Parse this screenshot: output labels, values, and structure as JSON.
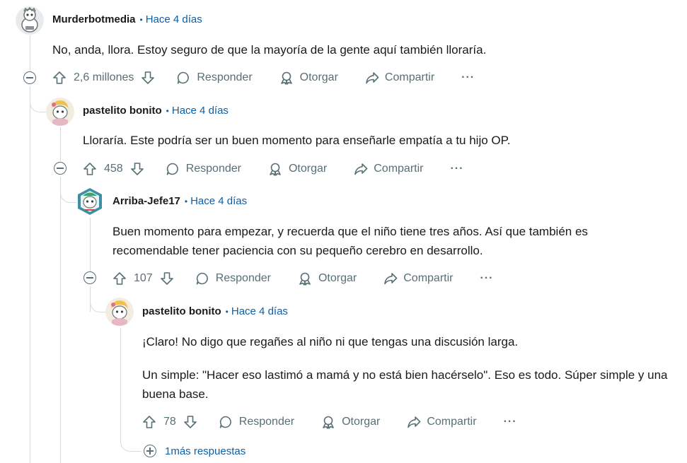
{
  "comments": [
    {
      "author": "Murderbotmedia",
      "time": "Hace 4 días",
      "body": [
        "No, anda, llora. Estoy seguro de que la mayoría de la gente aquí también lloraría."
      ],
      "votes": "2,6 millones",
      "reply": "Responder",
      "award": "Otorgar",
      "share": "Compartir",
      "more": "···"
    },
    {
      "author": "pastelito bonito",
      "time": "Hace 4 días",
      "body": [
        "Lloraría. Este podría ser un buen momento para enseñarle empatía a tu hijo OP."
      ],
      "votes": "458",
      "reply": "Responder",
      "award": "Otorgar",
      "share": "Compartir",
      "more": "···"
    },
    {
      "author": "Arriba-Jefe17",
      "time": "Hace 4 días",
      "body": [
        "Buen momento para empezar, y recuerda que el niño tiene tres años. Así que también es recomendable tener paciencia con su pequeño cerebro en desarrollo."
      ],
      "votes": "107",
      "reply": "Responder",
      "award": "Otorgar",
      "share": "Compartir",
      "more": "···"
    },
    {
      "author": "pastelito bonito",
      "time": "Hace 4 días",
      "body": [
        "¡Claro! No digo que regañes al niño ni que tengas una discusión larga.",
        "Un simple: \"Hacer eso lastimó a mamá y no está bien hacérselo\". Eso es todo. Súper simple y una buena base."
      ],
      "votes": "78",
      "reply": "Responder",
      "award": "Otorgar",
      "share": "Compartir",
      "more": "···"
    }
  ],
  "more_replies": {
    "count": "1",
    "label": "más respuestas"
  },
  "colors": {
    "link_blue": "#0a5fa8",
    "icon_gray": "#576f76",
    "thread_line": "#d7dadc"
  },
  "icons": [
    "upvote-icon",
    "downvote-icon",
    "comment-icon",
    "award-icon",
    "share-icon",
    "overflow-icon",
    "collapse-icon",
    "expand-icon"
  ]
}
